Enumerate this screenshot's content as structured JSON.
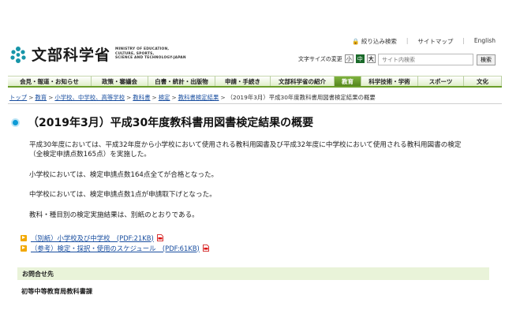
{
  "header": {
    "logo_jp": "文部科学省",
    "logo_en_lines": [
      "MINISTRY OF EDUCATION,",
      "CULTURE, SPORTS,",
      "SCIENCE AND TECHNOLOGY-JAPAN"
    ],
    "util_links": [
      "絞り込み検索",
      "サイトマップ",
      "English"
    ],
    "textsize_label": "文字サイズの変更",
    "textsize_small": "小",
    "textsize_medium": "中",
    "textsize_large": "大",
    "search_placeholder": "サイト内検索",
    "search_button": "検索"
  },
  "nav": {
    "items": [
      {
        "label": "会見・報道・お知らせ",
        "active": false
      },
      {
        "label": "政策・審議会",
        "active": false
      },
      {
        "label": "白書・統計・出版物",
        "active": false
      },
      {
        "label": "申請・手続き",
        "active": false
      },
      {
        "label": "文部科学省の紹介",
        "active": false
      },
      {
        "label": "教育",
        "active": true
      },
      {
        "label": "科学技術・学術",
        "active": false
      },
      {
        "label": "スポーツ",
        "active": false
      },
      {
        "label": "文化",
        "active": false
      }
    ]
  },
  "breadcrumb": {
    "links": [
      "トップ",
      "教育",
      "小学校、中学校、高等学校",
      "教科書",
      "検定",
      "教科書検定結果"
    ],
    "current": "（2019年3月）平成30年度教科書用図書検定結果の概要"
  },
  "main": {
    "title": "（2019年3月）平成30年度教科書用図書検定結果の概要",
    "para1_line1": "平成30年度においては、平成32年度から小学校において使用される教科用図書及び平成32年度に中学校において使用される教科用図書の検定",
    "para1_line2": "（全検定申請点数165点）を実施した。",
    "para2": "小学校においては、検定申請点数164点全てが合格となった。",
    "para3": "中学校においては、検定申請点数1点が申請取下げとなった。",
    "para4": "教科・種目別の検定実施結果は、別紙のとおりである。",
    "links": [
      "（別紙）小学校及び中学校　(PDF:21KB)",
      "（参考）検定・採択・使用のスケジュール　(PDF:61KB)"
    ],
    "contact_heading": "お問合せ先",
    "contact_dept": "初等中等教育局教科書課"
  },
  "colors": {
    "accent_green": "#6a9e2a",
    "link_blue": "#1a4fa0",
    "title_icon_blue": "#0e9bd6",
    "bullet_orange": "#f2a800"
  }
}
